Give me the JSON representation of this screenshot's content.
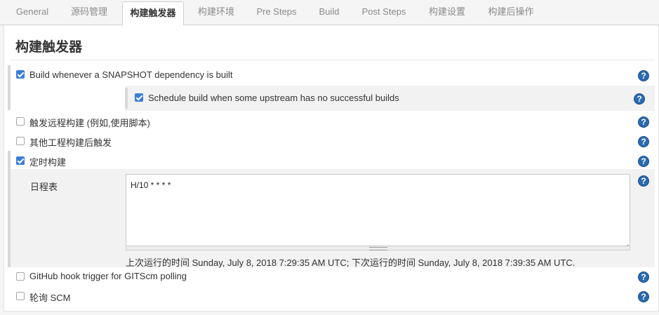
{
  "tabs": [
    {
      "label": "General",
      "active": false
    },
    {
      "label": "源码管理",
      "active": false
    },
    {
      "label": "构建触发器",
      "active": true
    },
    {
      "label": "构建环境",
      "active": false
    },
    {
      "label": "Pre Steps",
      "active": false
    },
    {
      "label": "Build",
      "active": false
    },
    {
      "label": "Post Steps",
      "active": false
    },
    {
      "label": "构建设置",
      "active": false
    },
    {
      "label": "构建后操作",
      "active": false
    }
  ],
  "section": {
    "title": "构建触发器",
    "options": [
      {
        "label": "Build whenever a SNAPSHOT dependency is built",
        "checked": true
      },
      {
        "label": "Schedule build when some upstream has no successful builds",
        "checked": true
      },
      {
        "label": "触发远程构建 (例如,使用脚本)",
        "checked": false
      },
      {
        "label": "其他工程构建后触发",
        "checked": false
      },
      {
        "label": "定时构建",
        "checked": true
      },
      {
        "label": "GitHub hook trigger for GITScm polling",
        "checked": false
      },
      {
        "label": "轮询 SCM",
        "checked": false
      }
    ],
    "schedule": {
      "label": "日程表",
      "value": "H/10 * * * *",
      "info": "上次运行的时间 Sunday, July 8, 2018 7:29:35 AM UTC; 下次运行的时间 Sunday, July 8, 2018 7:39:35 AM UTC."
    }
  },
  "icons": {
    "help": "help-icon"
  },
  "colors": {
    "help": "#2a6ab1",
    "checkbox_checked": "#3b7dd8"
  }
}
